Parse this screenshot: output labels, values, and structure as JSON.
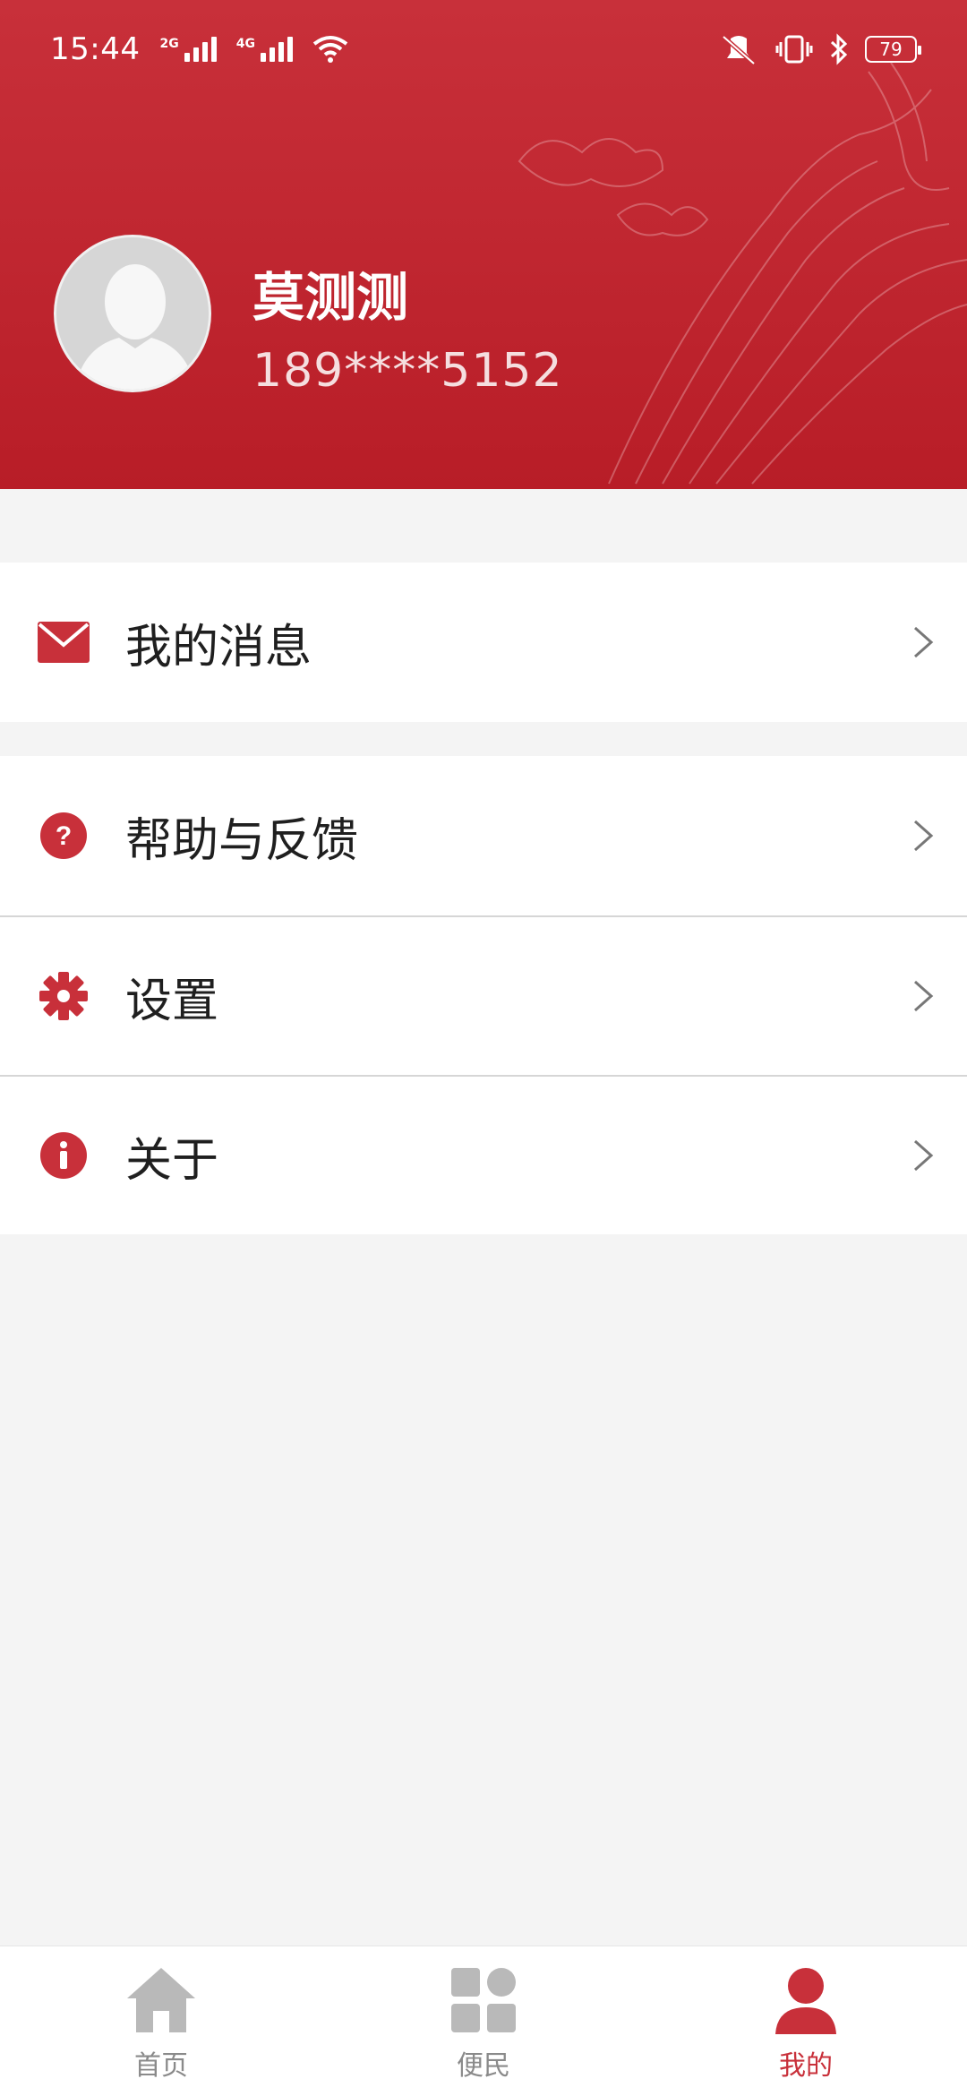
{
  "status_bar": {
    "time": "15:44",
    "signal_1_label": "2G",
    "signal_2_label": "4G",
    "battery": "79"
  },
  "profile": {
    "name": "莫测测",
    "phone": "189****5152"
  },
  "menu": {
    "messages": "我的消息",
    "help": "帮助与反馈",
    "settings": "设置",
    "about": "关于"
  },
  "tabs": [
    {
      "label": "首页",
      "icon": "home-icon"
    },
    {
      "label": "便民",
      "icon": "grid-icon"
    },
    {
      "label": "我的",
      "icon": "person-icon",
      "active": true
    }
  ],
  "colors": {
    "brand": "#c8303a",
    "inactive": "#b9b9b9"
  }
}
